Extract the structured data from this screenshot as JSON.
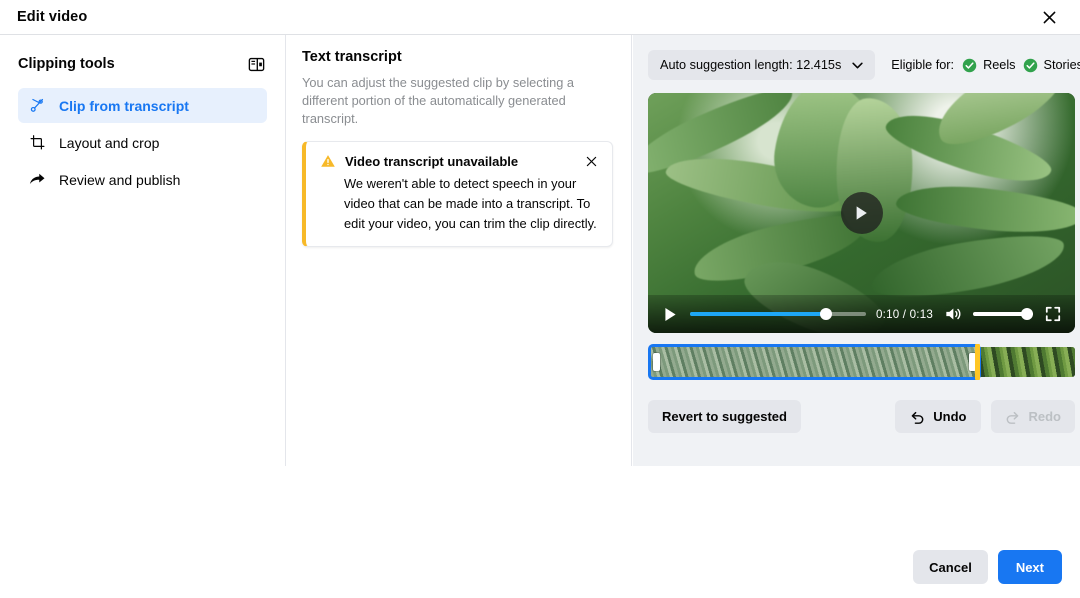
{
  "header": {
    "title": "Edit video",
    "close_icon": "close-icon"
  },
  "sidebar": {
    "title": "Clipping tools",
    "panel_icon": "panel-toggle-icon",
    "items": [
      {
        "label": "Clip from transcript",
        "icon": "scissors-icon",
        "active": true
      },
      {
        "label": "Layout and crop",
        "icon": "crop-icon",
        "active": false
      },
      {
        "label": "Review and publish",
        "icon": "share-arrow-icon",
        "active": false
      }
    ]
  },
  "transcript": {
    "title": "Text transcript",
    "description": "You can adjust the suggested clip by selecting a different portion of the automatically generated transcript.",
    "alert": {
      "icon": "warning-triangle-icon",
      "title": "Video transcript unavailable",
      "body": "We weren't able to detect speech in your video that can be made into a transcript. To edit your video, you can trim the clip directly.",
      "close_icon": "close-icon",
      "accent_color": "#f7b928"
    }
  },
  "preview": {
    "suggestion_chip": {
      "label": "Auto suggestion length: 12.415s",
      "caret_icon": "chevron-down-icon"
    },
    "eligible": {
      "label": "Eligible for:",
      "items": [
        {
          "label": "Reels",
          "icon": "check-circle-icon",
          "color": "#31a24c"
        },
        {
          "label": "Stories",
          "icon": "check-circle-icon",
          "color": "#31a24c"
        }
      ]
    },
    "video": {
      "play_overlay_icon": "play-icon",
      "controls": {
        "play_icon": "play-icon",
        "current_time": "0:10",
        "separator": "/",
        "duration": "0:13",
        "time_display": "0:10 / 0:13",
        "progress_percent": 77,
        "volume_icon": "volume-icon",
        "volume_percent": 100,
        "fullscreen_icon": "fullscreen-icon"
      }
    },
    "timeline": {
      "selection_start_percent": 0,
      "selection_end_percent": 78,
      "playhead_percent": 76.6,
      "selection_color": "#1877f2",
      "playhead_color": "#ffc624"
    },
    "actions": {
      "revert_label": "Revert to suggested",
      "undo_label": "Undo",
      "undo_icon": "undo-arrow-icon",
      "redo_label": "Redo",
      "redo_icon": "redo-arrow-icon",
      "redo_disabled": true
    }
  },
  "footer": {
    "cancel_label": "Cancel",
    "next_label": "Next",
    "primary_color": "#1877f2"
  }
}
